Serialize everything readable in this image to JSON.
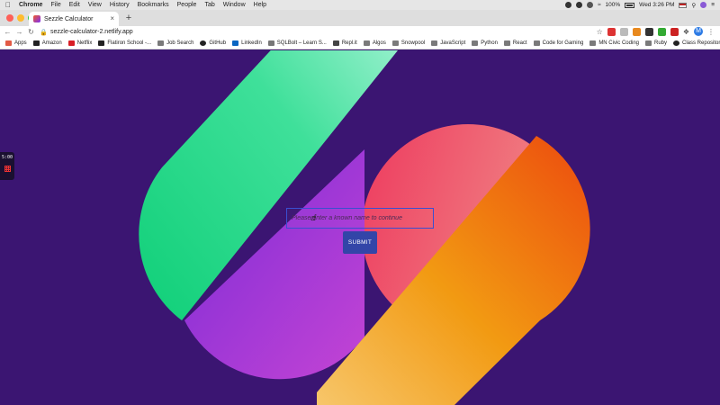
{
  "menubar": {
    "app": "Chrome",
    "items": [
      "File",
      "Edit",
      "View",
      "History",
      "Bookmarks",
      "People",
      "Tab",
      "Window",
      "Help"
    ],
    "battery": "100%",
    "clock": "Wed 3:26 PM"
  },
  "tab": {
    "title": "Sezzle Calculator"
  },
  "toolbar": {
    "url": "sezzle-calculator-2.netlify.app",
    "avatar_letter": "M"
  },
  "bookmarks": [
    {
      "label": "Apps",
      "icon": "apps-grid-icon",
      "color": "#e25b45"
    },
    {
      "label": "Amazon",
      "icon": "amazon-icon",
      "color": "#222222"
    },
    {
      "label": "Netflix",
      "icon": "netflix-icon",
      "color": "#d81f26"
    },
    {
      "label": "Flatiron School -...",
      "icon": "flatiron-icon",
      "color": "#222222"
    },
    {
      "label": "Job Search",
      "icon": "folder-icon",
      "color": "#7a7a7a"
    },
    {
      "label": "GitHub",
      "icon": "github-icon",
      "color": "#222222"
    },
    {
      "label": "LinkedIn",
      "icon": "linkedin-icon",
      "color": "#0a66c2"
    },
    {
      "label": "SQLBolt – Learn S...",
      "icon": "sqlbolt-icon",
      "color": "#777777"
    },
    {
      "label": "Repl.it",
      "icon": "replit-icon",
      "color": "#444444"
    },
    {
      "label": "Algos",
      "icon": "folder-icon",
      "color": "#7a7a7a"
    },
    {
      "label": "Snowpool",
      "icon": "folder-icon",
      "color": "#7a7a7a"
    },
    {
      "label": "JavaScript",
      "icon": "folder-icon",
      "color": "#7a7a7a"
    },
    {
      "label": "Python",
      "icon": "folder-icon",
      "color": "#7a7a7a"
    },
    {
      "label": "React",
      "icon": "folder-icon",
      "color": "#7a7a7a"
    },
    {
      "label": "Code for Gaming",
      "icon": "folder-icon",
      "color": "#7a7a7a"
    },
    {
      "label": "MN Civic Coding",
      "icon": "folder-icon",
      "color": "#7a7a7a"
    },
    {
      "label": "Ruby",
      "icon": "folder-icon",
      "color": "#7a7a7a"
    },
    {
      "label": "Class Repository (...",
      "icon": "github-icon",
      "color": "#222222"
    }
  ],
  "form": {
    "placeholder": "Please enter a known name to continue",
    "submit_label": "SUBMIT"
  },
  "side_widget": {
    "timer": "5:00"
  },
  "colors": {
    "page_background": "#3b1572",
    "green_shape": "#14d47f",
    "pink_shape": "#ef4766",
    "orange_shape": "#f08a10",
    "purple_shape": "#9a2ee0",
    "submit_button": "#3345a8"
  }
}
